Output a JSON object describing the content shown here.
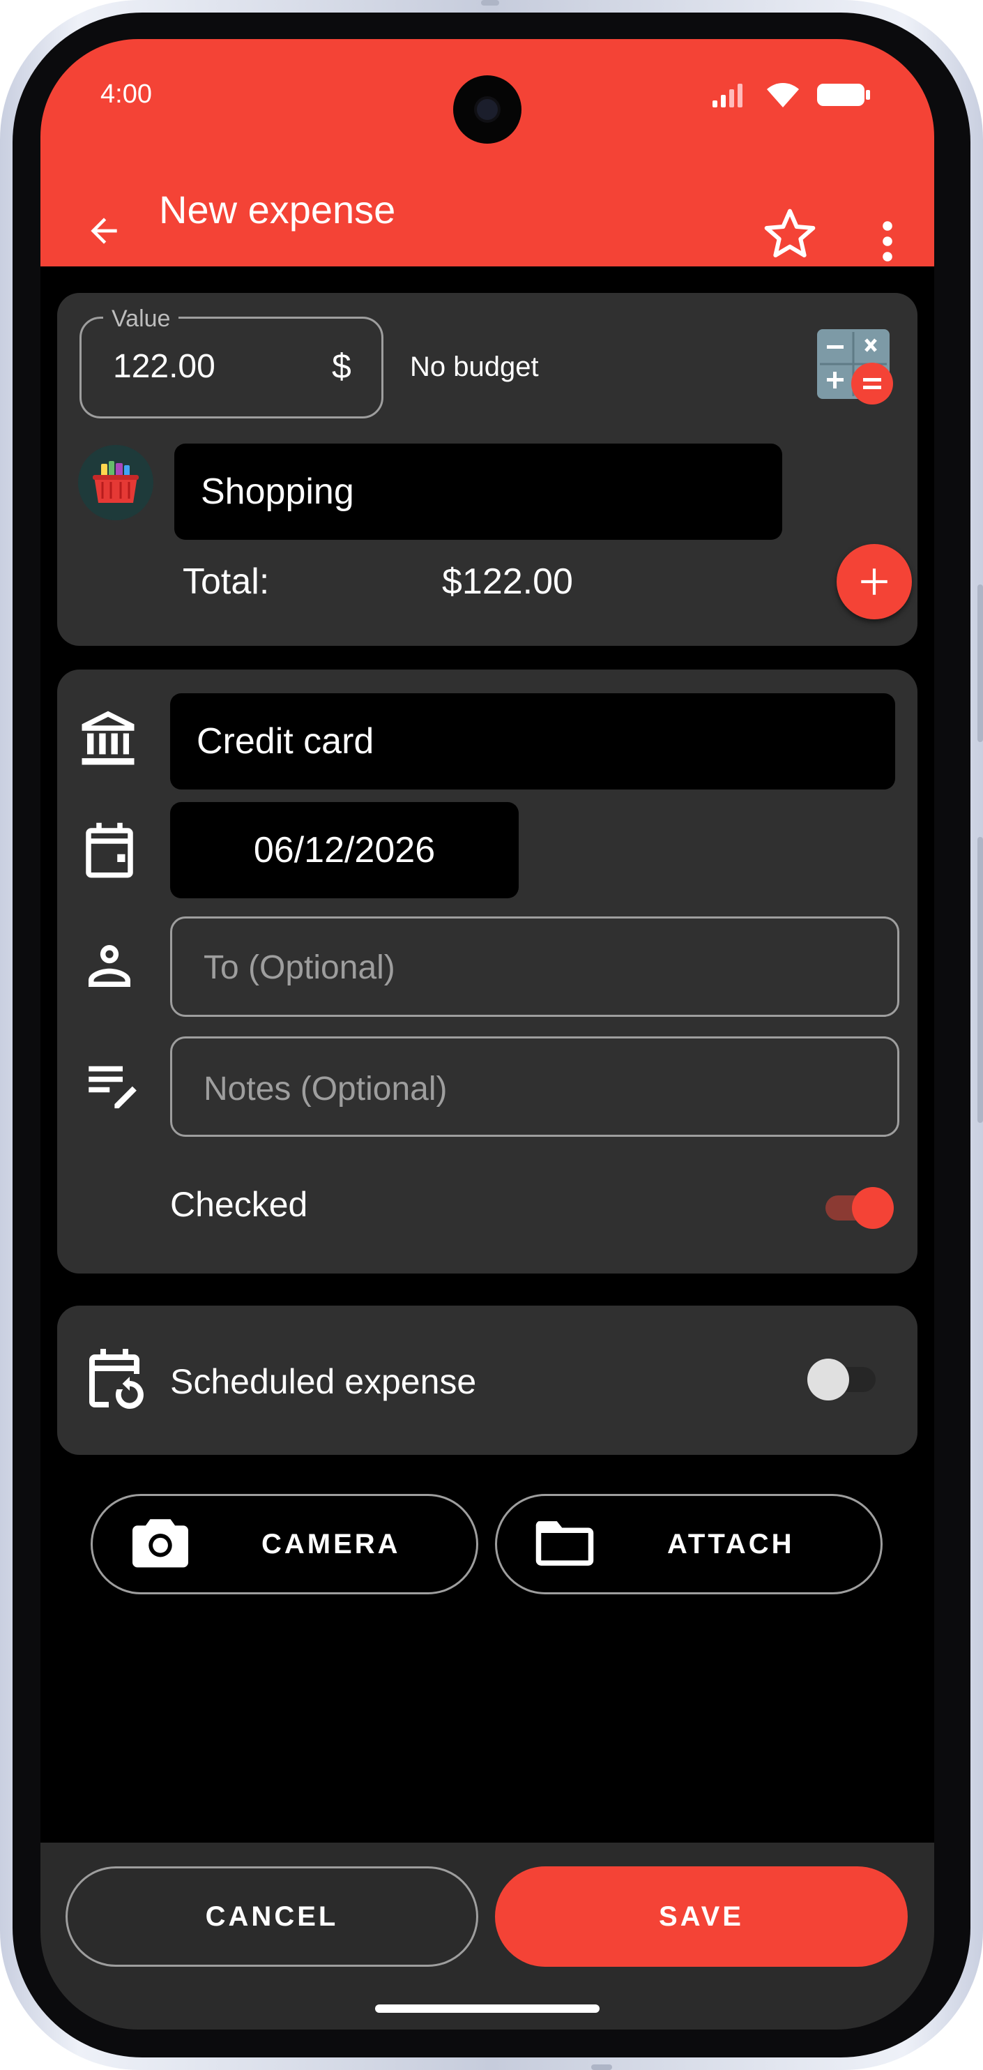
{
  "status": {
    "time": "4:00"
  },
  "appbar": {
    "title": "New expense",
    "back_icon": "arrow-left-icon",
    "star_icon": "star-outline-icon",
    "more_icon": "more-vert-icon"
  },
  "amount": {
    "label": "Value",
    "value": "122.00",
    "currency": "$",
    "budget_text": "No budget",
    "calculator_icon": "calculator-icon",
    "category": "Shopping",
    "category_icon": "shopping-basket-icon",
    "total_label": "Total:",
    "total_value": "$122.00",
    "add_icon": "plus-icon"
  },
  "details": {
    "account": "Credit card",
    "account_icon": "bank-icon",
    "date": "06/12/2026",
    "date_icon": "calendar-icon",
    "to_placeholder": "To (Optional)",
    "to_icon": "person-icon",
    "notes_placeholder": "Notes (Optional)",
    "notes_icon": "notes-edit-icon",
    "checked_label": "Checked",
    "checked": true
  },
  "schedule": {
    "label": "Scheduled expense",
    "icon": "calendar-repeat-icon",
    "enabled": false
  },
  "attachments": {
    "camera_label": "CAMERA",
    "attach_label": "ATTACH",
    "camera_icon": "camera-icon",
    "folder_icon": "folder-icon"
  },
  "footer": {
    "cancel_label": "CANCEL",
    "save_label": "SAVE"
  },
  "colors": {
    "accent": "#f44336",
    "card": "#303030",
    "background": "#000000"
  }
}
